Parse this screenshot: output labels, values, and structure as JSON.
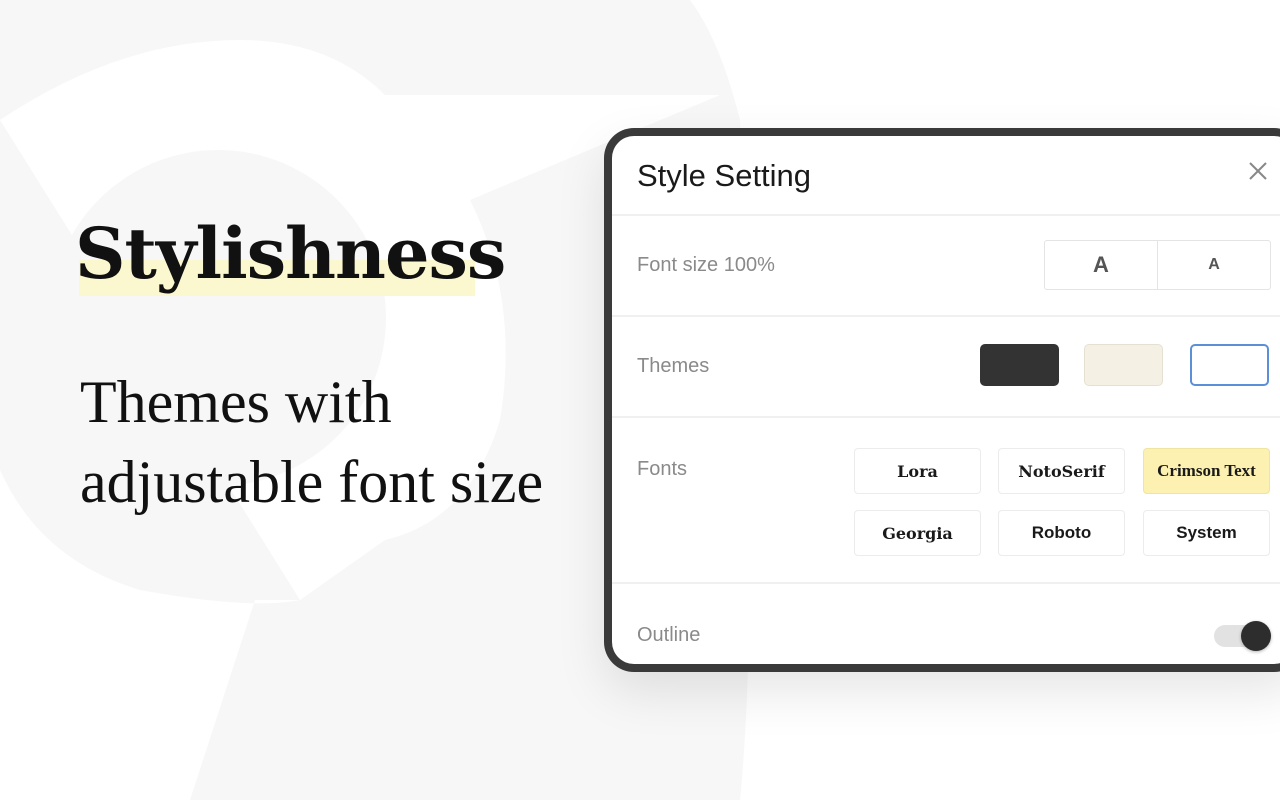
{
  "hero": {
    "title": "Stylishness",
    "subtitle_line1": "Themes with",
    "subtitle_line2": "adjustable font size",
    "highlight_color": "#fbf8cf"
  },
  "panel": {
    "title": "Style Setting",
    "close_icon": "close-icon",
    "font_size": {
      "label": "Font size",
      "value": "100%",
      "increase_label": "A",
      "decrease_label": "A"
    },
    "themes": {
      "label": "Themes",
      "options": [
        {
          "name": "dark",
          "color": "#333333",
          "selected": false
        },
        {
          "name": "sepia",
          "color": "#f5f0e4",
          "selected": false
        },
        {
          "name": "light",
          "color": "#ffffff",
          "selected": true
        }
      ],
      "selected_border_color": "#5b8fd8"
    },
    "fonts": {
      "label": "Fonts",
      "options": [
        {
          "label": "Lora",
          "selected": false
        },
        {
          "label": "NotoSerif",
          "selected": false
        },
        {
          "label": "Crimson Text",
          "selected": true
        },
        {
          "label": "Georgia",
          "selected": false
        },
        {
          "label": "Roboto",
          "selected": false
        },
        {
          "label": "System",
          "selected": false
        }
      ],
      "selected_color": "#fcf1b0"
    },
    "outline": {
      "label": "Outline",
      "enabled": true
    }
  }
}
